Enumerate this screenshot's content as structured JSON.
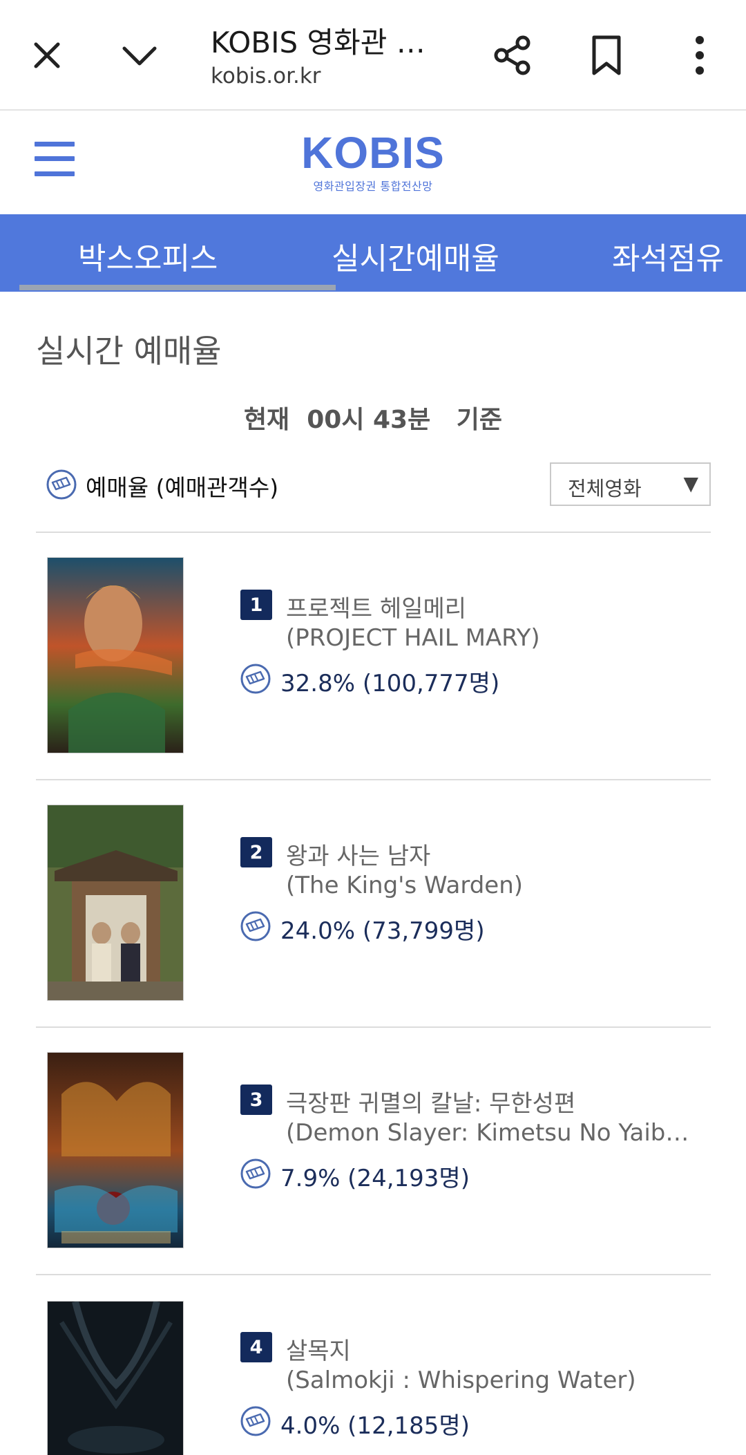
{
  "browser": {
    "title": "KOBIS 영화관 입...",
    "url": "kobis.or.kr"
  },
  "site": {
    "brand": "KOBIS",
    "subtitle": "영화관입장권 통합전산망"
  },
  "nav": {
    "tabs": [
      {
        "label": "박스오피스"
      },
      {
        "label": "실시간예매율"
      },
      {
        "label": "좌석점유"
      }
    ]
  },
  "content": {
    "section_title": "실시간 예매율",
    "basis": "현재  00시 43분   기준",
    "legend_label": "예매율 (예매관객수)",
    "filter": {
      "selected": "전체영화",
      "arrow": "▼"
    }
  },
  "movies": [
    {
      "rank": "1",
      "title": "프로젝트 헤일메리",
      "title_en": "(PROJECT HAIL MARY)",
      "rate": "32.8% (100,777명)"
    },
    {
      "rank": "2",
      "title": "왕과 사는 남자",
      "title_en": "(The King's Warden)",
      "rate": "24.0% (73,799명)"
    },
    {
      "rank": "3",
      "title": "극장판 귀멸의 칼날: 무한성편",
      "title_en": "(Demon Slayer: Kimetsu No Yaiba I…",
      "rate": "7.9% (24,193명)"
    },
    {
      "rank": "4",
      "title": "살목지",
      "title_en": "(Salmokji : Whispering Water)",
      "rate": "4.0% (12,185명)"
    }
  ],
  "colors": {
    "brand_blue": "#4f74d9",
    "nav_blue": "#5078dc",
    "rank_navy": "#132a5c"
  }
}
